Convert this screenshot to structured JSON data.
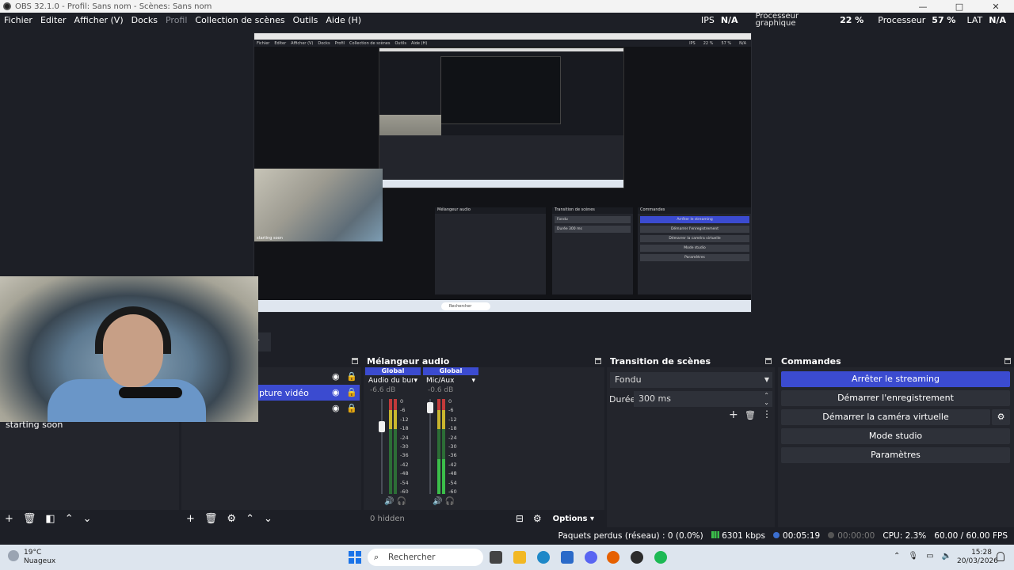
{
  "window": {
    "title": "OBS 32.1.0 - Profil: Sans nom - Scènes: Sans nom",
    "controls": [
      "—",
      "□",
      "✕"
    ]
  },
  "menu": [
    "Fichier",
    "Editer",
    "Afficher (V)",
    "Docks",
    "Profil",
    "Collection de scènes",
    "Outils",
    "Aide (H)"
  ],
  "stats": {
    "fps_label": "IPS",
    "fps_value": "N/A",
    "gpu_label_line1": "Processeur",
    "gpu_label_line2": "graphique",
    "gpu_value": "22 %",
    "cpu_label": "Processeur",
    "cpu_value": "57 %",
    "lat_label": "LAT",
    "lat_value": "N/A"
  },
  "preview": {
    "camera_label": "starting soon",
    "mixer_title": "Mélangeur audio",
    "transition_title": "Transition de scènes",
    "controls_title": "Commandes",
    "transition_value": "Fondu",
    "duration_label": "Durée",
    "duration_value": "300 ms",
    "buttons": [
      "Arrêter le streaming",
      "Démarrer l'enregistrement",
      "Démarrer la caméra virtuelle",
      "Mode studio",
      "Paramètres"
    ],
    "search": "Rechercher"
  },
  "midbar": {
    "chip": "er"
  },
  "camera": {
    "label": "starting soon"
  },
  "sources": {
    "rows": [
      {
        "name": ""
      },
      {
        "name": "pture vidéo"
      },
      {
        "name": ""
      }
    ]
  },
  "mixer": {
    "title": "Mélangeur audio",
    "channels": [
      {
        "global": "Global",
        "name": "Audio du bureau",
        "db": "-6.6 dB"
      },
      {
        "global": "Global",
        "name": "Mic/Aux",
        "db": "-0.6 dB"
      }
    ],
    "ticks": [
      "0",
      "-6",
      "-12",
      "-18",
      "-24",
      "-30",
      "-36",
      "-42",
      "-48",
      "-54",
      "-60"
    ],
    "hidden": "0 hidden",
    "options": "Options"
  },
  "transition": {
    "title": "Transition de scènes",
    "value": "Fondu",
    "duration_label": "Durée",
    "duration_value": "300 ms"
  },
  "controls": {
    "title": "Commandes",
    "stop_streaming": "Arrêter le streaming",
    "start_recording": "Démarrer l'enregistrement",
    "start_virtualcam": "Démarrer la caméra virtuelle",
    "studio_mode": "Mode studio",
    "settings": "Paramètres"
  },
  "status": {
    "dropped": "Paquets perdus (réseau) : 0 (0.0%)",
    "bitrate": "6301 kbps",
    "stream_time": "00:05:19",
    "rec_time": "00:00:00",
    "cpu": "CPU: 2.3%",
    "fps": "60.00 / 60.00 FPS"
  },
  "taskbar": {
    "temp": "19°C",
    "weather": "Nuageux",
    "search": "Rechercher",
    "time": "15:28",
    "date": "20/03/2026"
  },
  "colors": {
    "accent": "#3b4bd0",
    "bg": "#1d1f26",
    "dock": "#23252c",
    "meter_green": "#3bbd4a",
    "meter_yellow": "#c9b62e",
    "meter_red": "#c23a3a"
  }
}
